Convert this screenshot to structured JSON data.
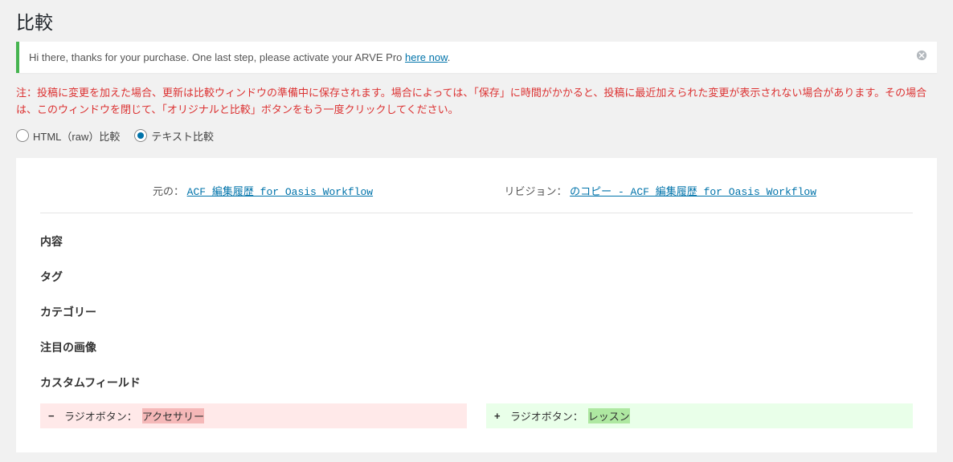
{
  "page_title": "比較",
  "notice": {
    "prefix": "Hi there, thanks for your purchase. One last step, please activate your ARVE Pro ",
    "link": "here now",
    "suffix": "."
  },
  "warning": "注：投稿に変更を加えた場合、更新は比較ウィンドウの準備中に保存されます。場合によっては、「保存」に時間がかかると、投稿に最近加えられた変更が表示されない場合があります。その場合は、このウィンドウを閉じて、「オリジナルと比較」ボタンをもう一度クリックしてください。",
  "radios": {
    "html_raw": "HTML（raw）比較",
    "text": "テキスト比較"
  },
  "compare": {
    "original_label": "元の：",
    "original_link": "ACF 編集履歴 for Oasis Workflow",
    "revision_label": "リビジョン：",
    "revision_link": "のコピー - ACF 編集履歴 for Oasis Workflow"
  },
  "sections": {
    "content": "内容",
    "tags": "タグ",
    "category": "カテゴリー",
    "featured": "注目の画像",
    "custom_fields": "カスタムフィールド"
  },
  "diff": {
    "minus": "−",
    "plus": "+",
    "del_label": "ラジオボタン：",
    "del_value": "アクセサリー",
    "add_label": "ラジオボタン：",
    "add_value": "レッスン"
  }
}
